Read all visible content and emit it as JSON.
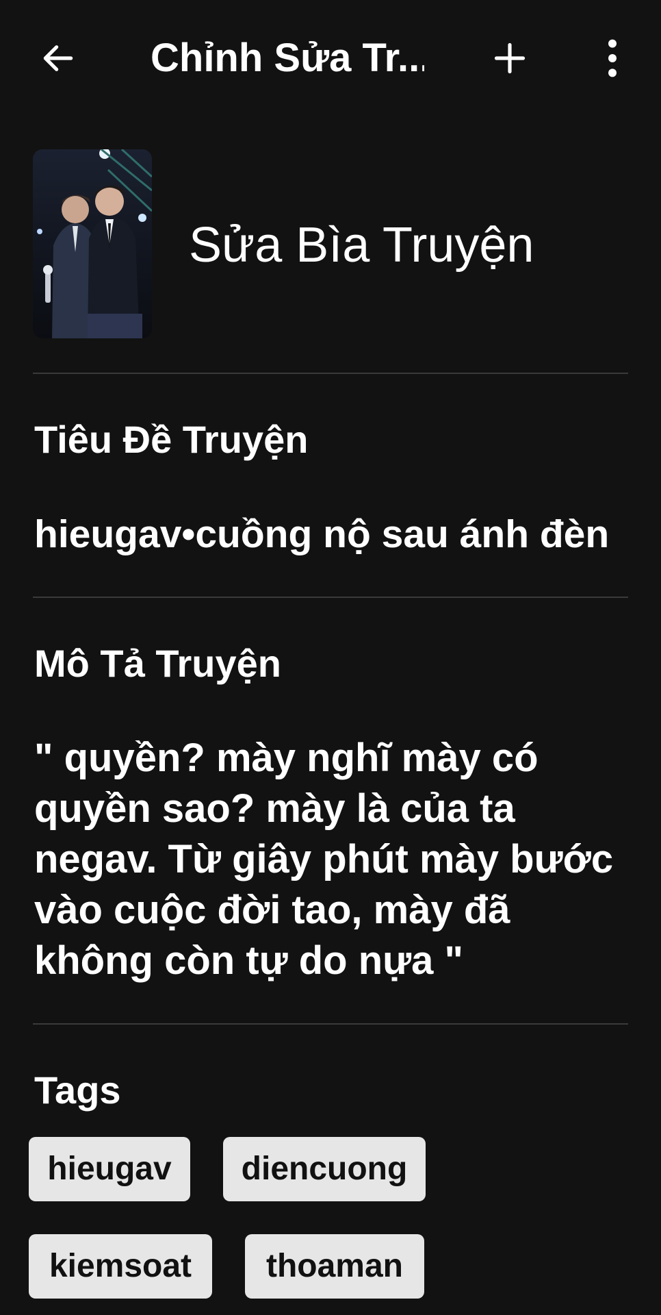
{
  "appbar": {
    "title": "Chỉnh Sửa Tr...",
    "back_icon": "arrow-left-icon",
    "add_icon": "plus-icon",
    "more_icon": "more-vertical-icon"
  },
  "cover": {
    "label": "Sửa Bìa Truyện"
  },
  "title_section": {
    "heading": "Tiêu Đề Truyện",
    "value": "hieugav•cuồng nộ sau ánh đèn"
  },
  "description_section": {
    "heading": "Mô Tả Truyện",
    "value": "\" quyền? mày nghĩ mày có quyền sao? mày là của ta negav. Từ giây phút mày bước vào cuộc đời tao, mày đã không còn tự do nựa \""
  },
  "tags_section": {
    "heading": "Tags",
    "tags": [
      "hieugav",
      "diencuong",
      "kiemsoat",
      "thoaman"
    ]
  },
  "colors": {
    "background": "#121212",
    "text": "#ffffff",
    "tag_background": "#e6e6e6",
    "divider": "#3a3a3a"
  }
}
